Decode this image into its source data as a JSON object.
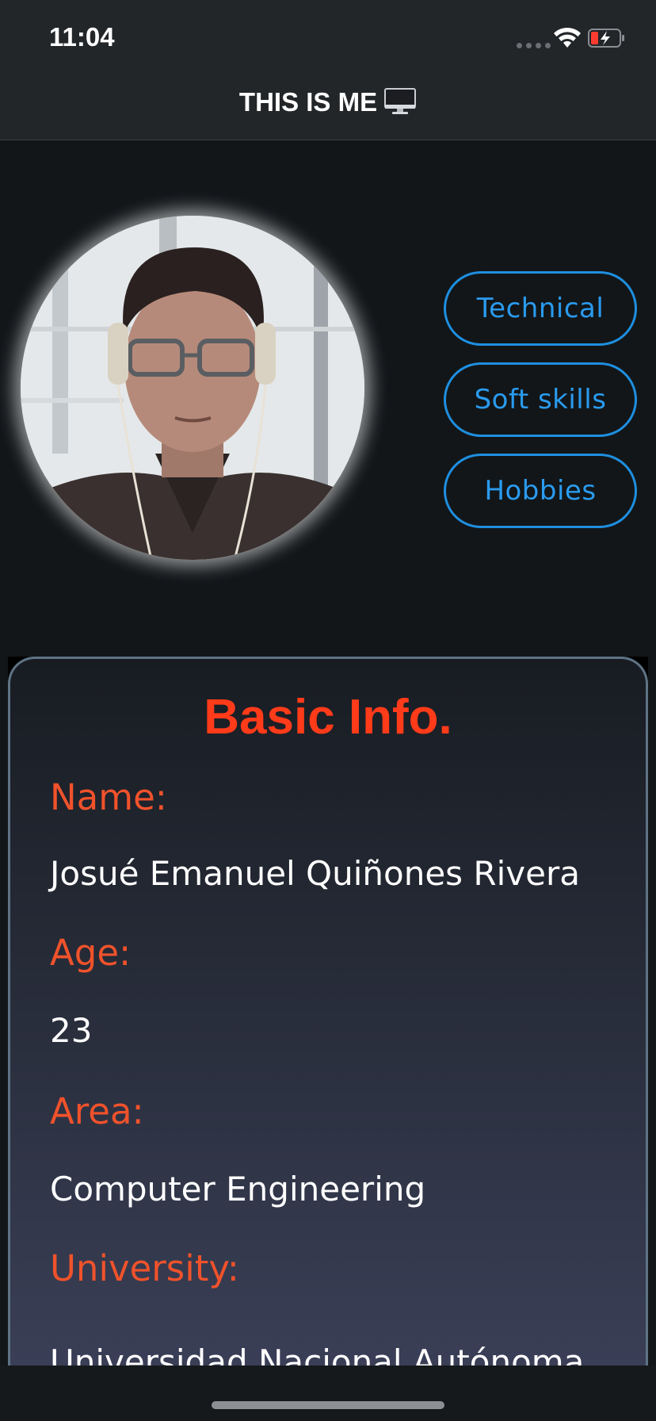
{
  "status_bar": {
    "time": "11:04"
  },
  "nav": {
    "title": "THIS IS ME",
    "title_icon": "desktop-computer-icon"
  },
  "profile": {
    "avatar_icon": "profile-photo"
  },
  "buttons": {
    "technical": "Technical",
    "soft_skills": "Soft skills",
    "hobbies": "Hobbies"
  },
  "basic_info": {
    "title": "Basic Info.",
    "fields": [
      {
        "label": "Name:",
        "value": "Josué Emanuel Quiñones Rivera"
      },
      {
        "label": "Age:",
        "value": "23"
      },
      {
        "label": "Area:",
        "value": "Computer Engineering"
      },
      {
        "label": "University:",
        "value": "Universidad Nacional Autónoma"
      }
    ]
  },
  "colors": {
    "accent_blue": "#1e8fe0",
    "accent_red": "#ff3b19",
    "background": "#121619",
    "bar": "#232629"
  }
}
